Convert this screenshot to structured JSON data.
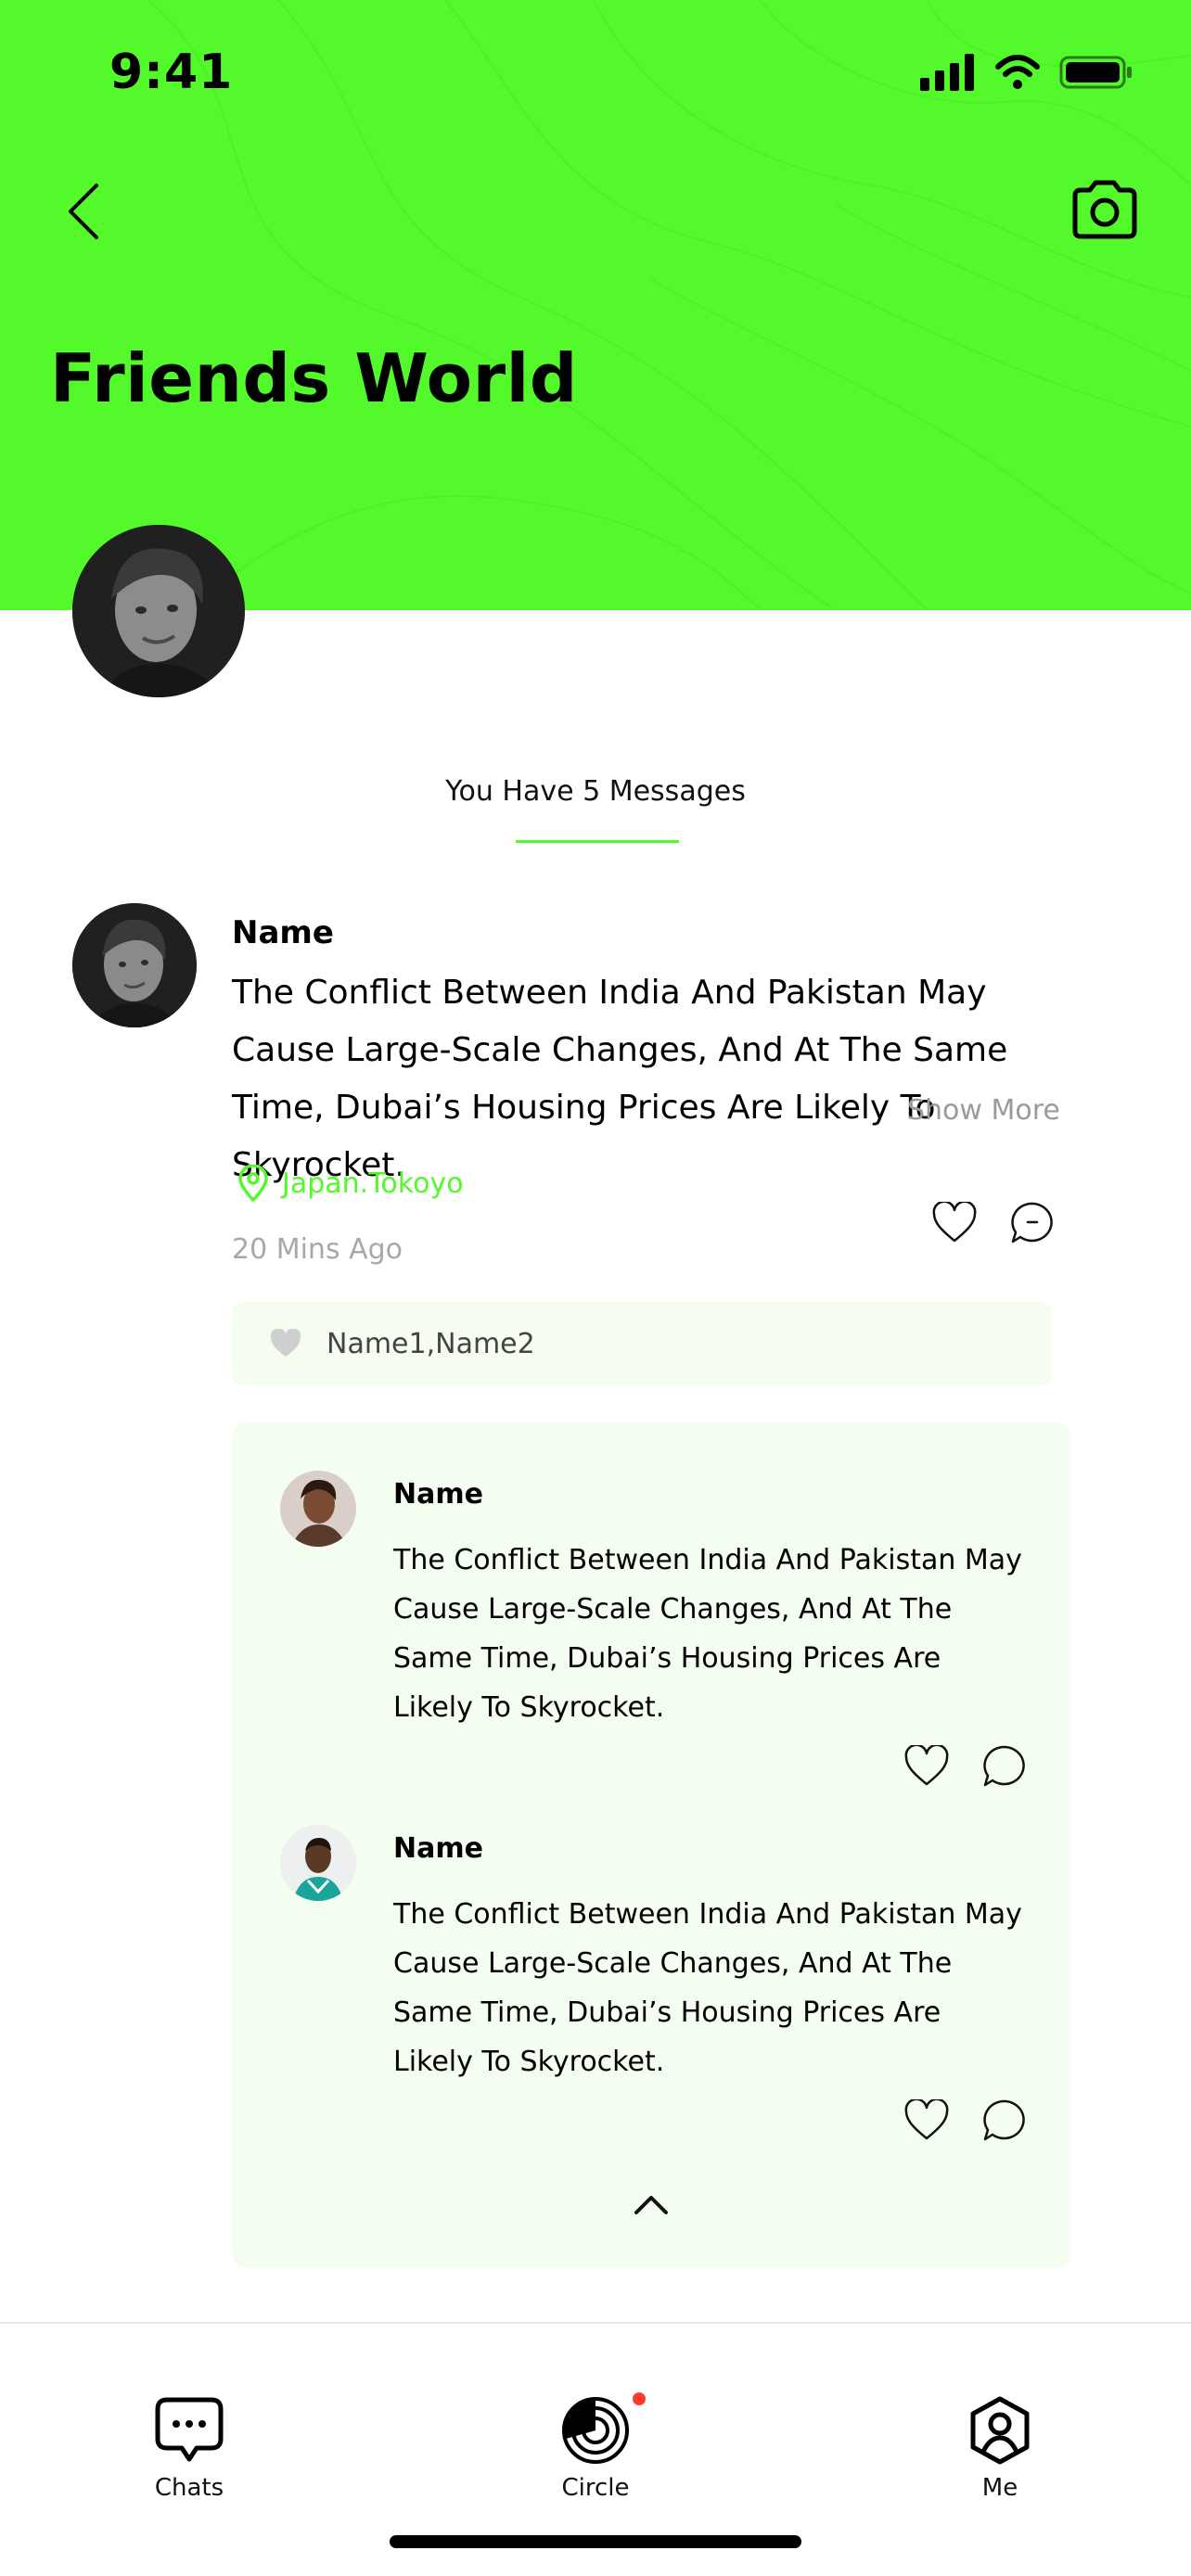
{
  "status_bar": {
    "time": "9:41"
  },
  "header": {
    "title": "Friends World",
    "back_icon": "chevron-left-icon",
    "camera_icon": "camera-icon",
    "background_color": "#53f92a"
  },
  "messages": {
    "count_text": "You Have 5 Messages",
    "accent_color": "#53f92a"
  },
  "post": {
    "name": "Name",
    "text": "The Conflict Between India And Pakistan May Cause Large-Scale Changes, And At The Same Time, Dubai’s Housing Prices Are Likely To Skyrocket.",
    "show_more": "Show More",
    "location": "Japan.Tokoyo",
    "time": "20 Mins Ago",
    "likes": "Name1,Name2"
  },
  "comments": [
    {
      "name": "Name",
      "text": "The Conflict Between India And Pakistan May Cause Large-Scale Changes, And At The Same Time, Dubai’s Housing Prices Are Likely To Skyrocket."
    },
    {
      "name": "Name",
      "text": "The Conflict Between India And Pakistan May Cause Large-Scale Changes, And At The Same Time, Dubai’s Housing Prices Are Likely To Skyrocket."
    }
  ],
  "tab_bar": {
    "items": [
      {
        "label": "Chats",
        "icon": "chat-bubble-icon"
      },
      {
        "label": "Circle",
        "icon": "circle-icon"
      },
      {
        "label": "Me",
        "icon": "user-icon"
      }
    ],
    "notification_color": "#ff3b30"
  }
}
